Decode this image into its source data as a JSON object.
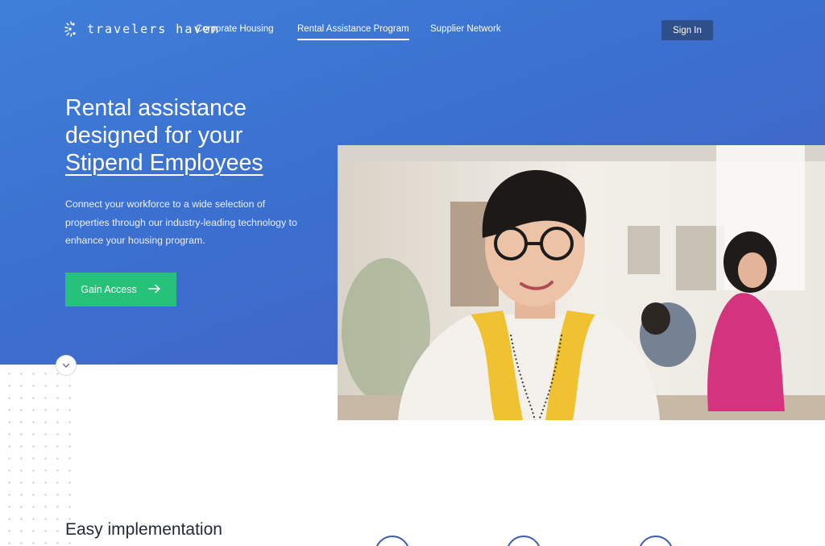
{
  "brand": {
    "name": "travelers haven",
    "logo_icon": "burst-logo-icon"
  },
  "nav": {
    "items": [
      {
        "label": "Corporate Housing",
        "active": false
      },
      {
        "label": "Rental Assistance Program",
        "active": true
      },
      {
        "label": "Supplier Network",
        "active": false
      }
    ],
    "signin_label": "Sign In"
  },
  "hero": {
    "headline_line1": "Rental assistance",
    "headline_line2": "designed for your",
    "headline_line3": "Stipend Employees",
    "subtext": "Connect your workforce to a wide selection of properties through our industry-leading technology to enhance your housing program.",
    "cta_label": "Gain Access",
    "cta_icon": "arrow-right-icon",
    "scroll_icon": "chevron-down-icon"
  },
  "section": {
    "title": "Easy implementation"
  },
  "colors": {
    "hero_blue": "#3f7fd8",
    "cta_green": "#27c27a",
    "signin_bg": "#2f4f8a",
    "circle_outline": "#3a5cb0"
  }
}
